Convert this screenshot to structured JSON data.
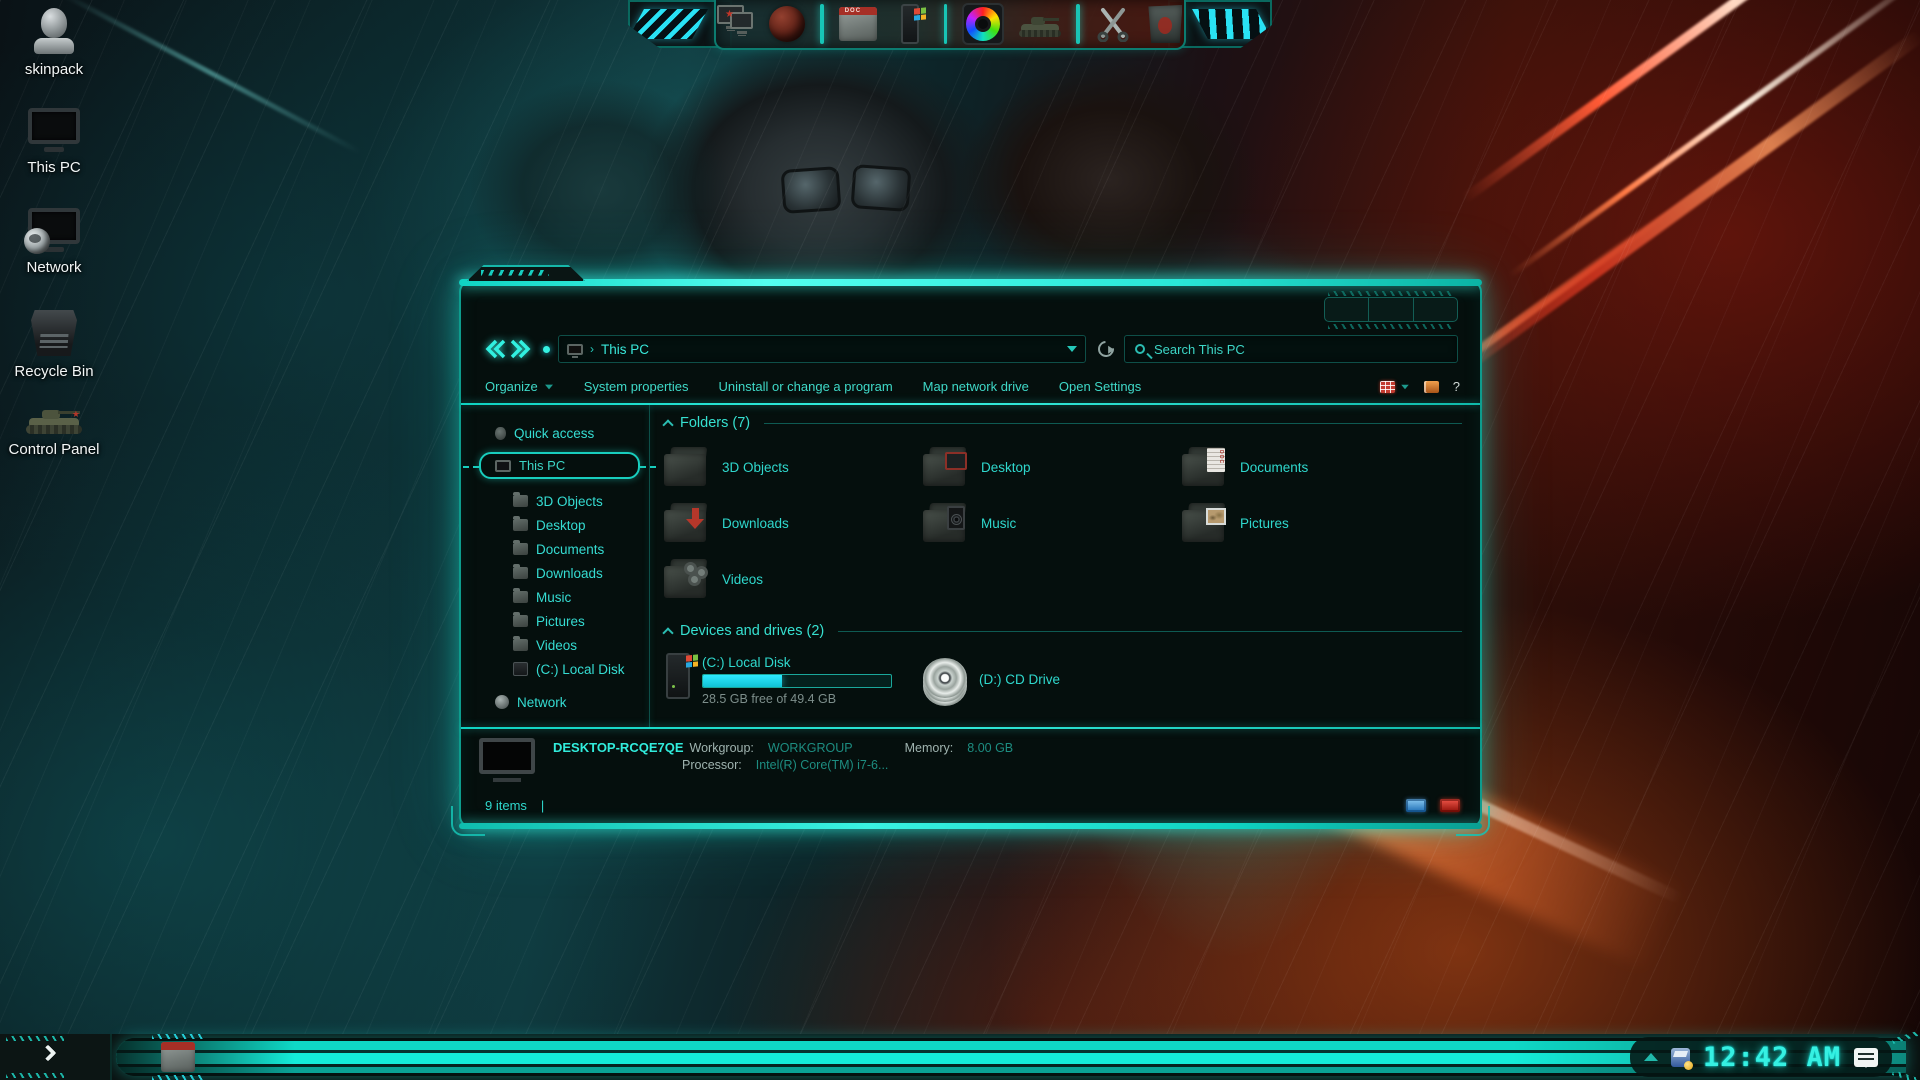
{
  "colors": {
    "neon": "#1fe9d6",
    "text_teal": "#3cd6c6",
    "bright_cyan": "#36f0e2",
    "red_accent": "#c23b30",
    "orange_accent": "#e8883a"
  },
  "desktop": {
    "icons": [
      {
        "label": "skinpack"
      },
      {
        "label": "This PC"
      },
      {
        "label": "Network"
      },
      {
        "label": "Recycle Bin"
      },
      {
        "label": "Control Panel"
      }
    ]
  },
  "dock": {
    "icon_names": [
      "camo-displays",
      "globe-browser",
      "documents-folder",
      "pc-tower",
      "color-wheel",
      "tank",
      "scissors",
      "recycle-bin"
    ],
    "doc_art": "DOC"
  },
  "win": {
    "nav": {
      "path": "This PC",
      "crumb_sep": "›",
      "search_placeholder": "Search This PC"
    },
    "toolbar": {
      "organize": "Organize",
      "system_properties": "System properties",
      "uninstall": "Uninstall or change a program",
      "map_drive": "Map network drive",
      "open_settings": "Open Settings",
      "help": "?"
    },
    "sidebar": {
      "items": [
        {
          "label": "Quick access"
        },
        {
          "label": "This PC"
        },
        {
          "label": "3D Objects"
        },
        {
          "label": "Desktop"
        },
        {
          "label": "Documents"
        },
        {
          "label": "Downloads"
        },
        {
          "label": "Music"
        },
        {
          "label": "Pictures"
        },
        {
          "label": "Videos"
        },
        {
          "label": "(C:) Local Disk"
        },
        {
          "label": "Network"
        }
      ]
    },
    "folders": {
      "title": "Folders (7)",
      "items": [
        {
          "label": "3D Objects"
        },
        {
          "label": "Desktop"
        },
        {
          "label": "Documents"
        },
        {
          "label": "Downloads"
        },
        {
          "label": "Music"
        },
        {
          "label": "Pictures"
        },
        {
          "label": "Videos"
        }
      ]
    },
    "drives": {
      "title": "Devices and drives (2)",
      "c": {
        "label": "(C:) Local Disk",
        "free": "28.5 GB free of 49.4 GB",
        "used_percent": 42
      },
      "d": {
        "label": "(D:) CD Drive"
      }
    },
    "details": {
      "name": "DESKTOP-RCQE7QE",
      "workgroup_label": "Workgroup:",
      "workgroup": "WORKGROUP",
      "memory_label": "Memory:",
      "memory": "8.00 GB",
      "processor_label": "Processor:",
      "processor": "Intel(R) Core(TM) i7-6..."
    },
    "status": {
      "count": "9 items",
      "sep": "|"
    }
  },
  "taskbar": {
    "clock": "12:42 AM"
  }
}
